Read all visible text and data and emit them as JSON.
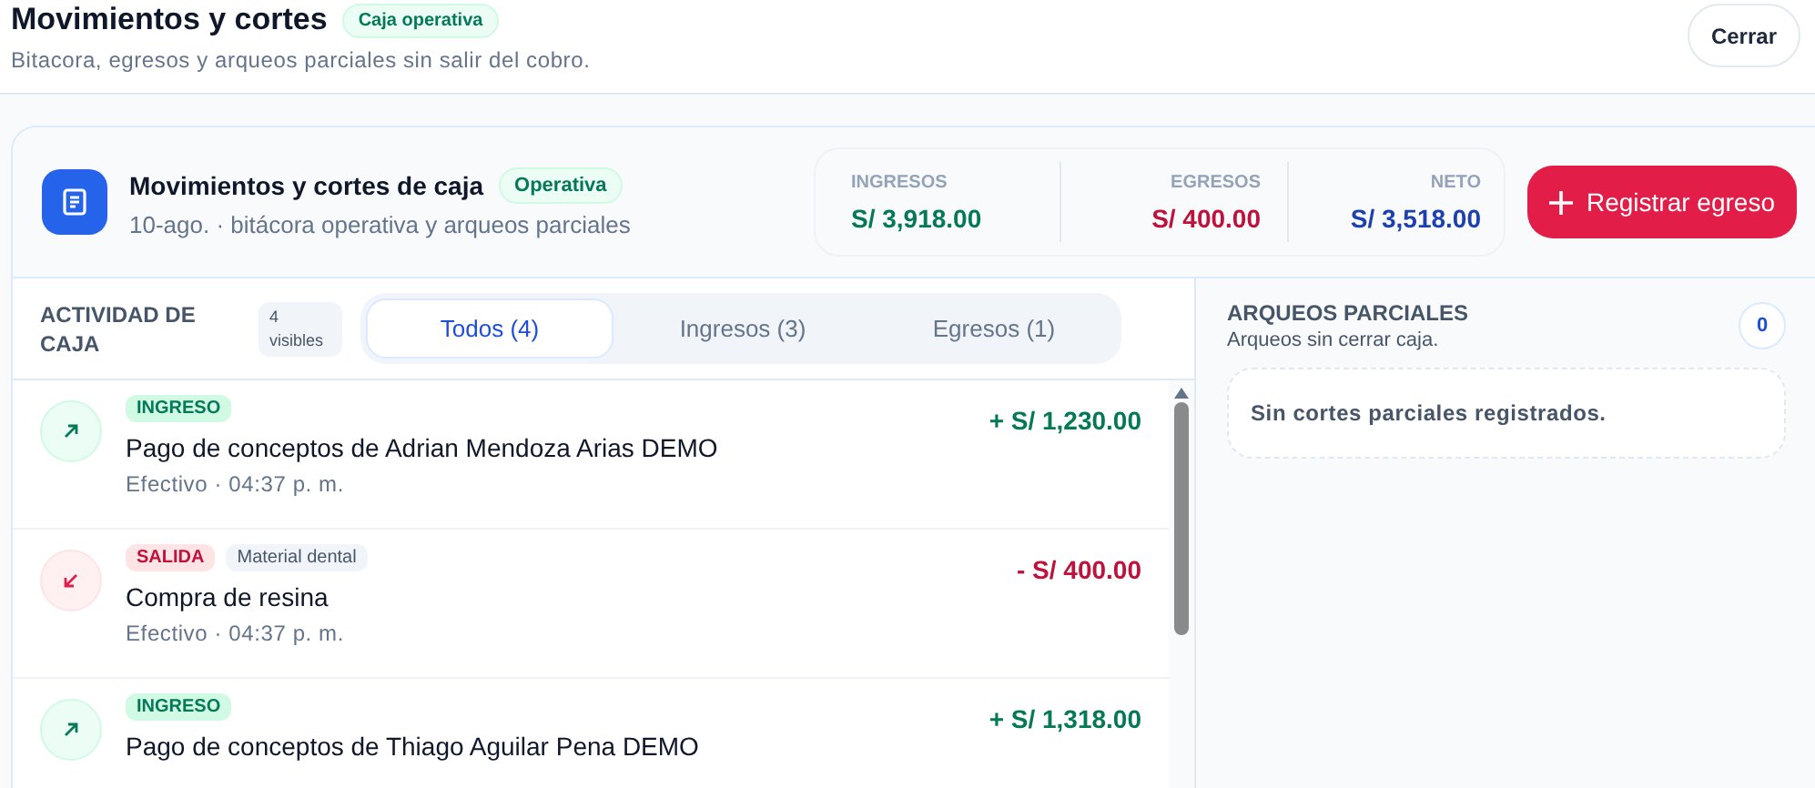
{
  "header": {
    "title": "Movimientos y cortes",
    "badge": "Caja operativa",
    "subtitle": "Bitacora, egresos y arqueos parciales sin salir del cobro.",
    "close_button": "Cerrar"
  },
  "card": {
    "title": "Movimientos y cortes de caja",
    "status": "Operativa",
    "subtitle": "10-ago. · bitácora operativa y arqueos parciales",
    "stats": [
      {
        "label": "INGRESOS",
        "value": "S/ 3,918.00",
        "kind": "income"
      },
      {
        "label": "EGRESOS",
        "value": "S/ 400.00",
        "kind": "expense"
      },
      {
        "label": "NETO",
        "value": "S/ 3,518.00",
        "kind": "net"
      }
    ],
    "action_button": "Registrar egreso"
  },
  "activity": {
    "title": "ACTIVIDAD DE CAJA",
    "count_badge": "4 visibles",
    "tabs": [
      {
        "label": "Todos (4)",
        "selected": true
      },
      {
        "label": "Ingresos (3)",
        "selected": false
      },
      {
        "label": "Egresos (1)",
        "selected": false
      }
    ],
    "rows": [
      {
        "kind": "in",
        "tag": "INGRESO",
        "description": "Pago de conceptos de Adrian Mendoza Arias DEMO",
        "meta": "Efectivo · 04:37 p. m.",
        "amount": "+ S/ 1,230.00"
      },
      {
        "kind": "out",
        "tag": "SALIDA",
        "category": "Material dental",
        "description": "Compra de resina",
        "meta": "Efectivo · 04:37 p. m.",
        "amount": "- S/ 400.00"
      },
      {
        "kind": "in",
        "tag": "INGRESO",
        "description": "Pago de conceptos de Thiago Aguilar Pena DEMO",
        "amount": "+ S/ 1,318.00"
      }
    ]
  },
  "partial_counts": {
    "title": "ARQUEOS PARCIALES",
    "subtitle": "Arqueos sin cerrar caja.",
    "count": "0",
    "empty_message": "Sin cortes parciales registrados."
  }
}
